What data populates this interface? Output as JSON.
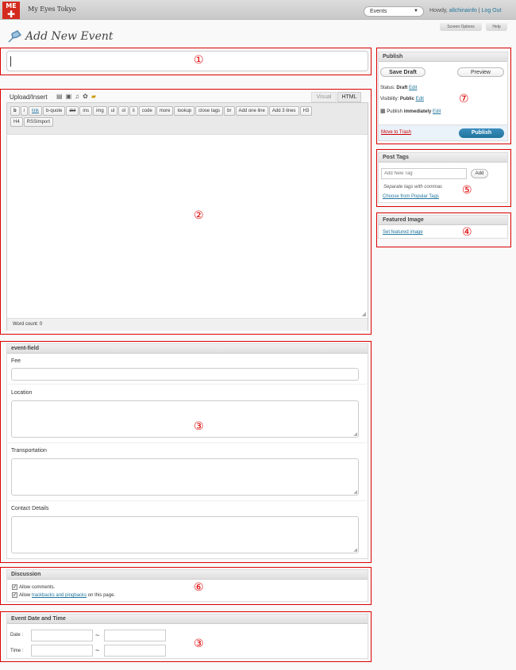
{
  "header": {
    "logo": "ME",
    "site_name": "My Eyes Tokyo",
    "post_type": "Events",
    "howdy": "Howdy,",
    "user": "allchinainfo",
    "logout": "Log Out",
    "screen_options": "Screen Options",
    "help": "Help"
  },
  "page_title": "Add New Event",
  "editor": {
    "upload_insert": "Upload/Insert",
    "tab_visual": "Visual",
    "tab_html": "HTML",
    "quicktags": [
      "b",
      "i",
      "link",
      "b-quote",
      "del",
      "ins",
      "img",
      "ul",
      "ol",
      "li",
      "code",
      "more",
      "lookup",
      "close tags",
      "br",
      "Add one line",
      "Add 3 lines",
      "H3",
      "H4",
      "RSSImport"
    ],
    "word_count": "Word count: 0"
  },
  "event_field": {
    "title": "event-field",
    "fee": "Fee",
    "location": "Location",
    "transportation": "Transportation",
    "contact": "Contact Details"
  },
  "discussion": {
    "title": "Discussion",
    "allow_comments": "Allow comments.",
    "allow_prefix": "Allow",
    "trackbacks_link": "trackbacks and pingbacks",
    "allow_suffix": "on this page."
  },
  "event_datetime": {
    "title": "Event Date and Time",
    "date_label": "Date :",
    "time_label": "Time :",
    "separator": "~"
  },
  "publish": {
    "title": "Publish",
    "save_draft": "Save Draft",
    "preview": "Preview",
    "status_label": "Status:",
    "status_value": "Draft",
    "visibility_label": "Visibility:",
    "visibility_value": "Public",
    "publish_label": "Publish",
    "publish_value": "immediately",
    "edit": "Edit",
    "move_to_trash": "Move to Trash",
    "publish_button": "Publish"
  },
  "post_tags": {
    "title": "Post Tags",
    "placeholder": "Add New Tag",
    "add": "Add",
    "hint": "Separate tags with commas",
    "popular": "Choose from Popular Tags"
  },
  "featured_image": {
    "title": "Featured Image",
    "set_link": "Set featured image"
  },
  "markers": {
    "m1": "①",
    "m2": "②",
    "m3": "③",
    "m4": "④",
    "m5": "⑤",
    "m6": "⑥",
    "m7": "⑦"
  }
}
